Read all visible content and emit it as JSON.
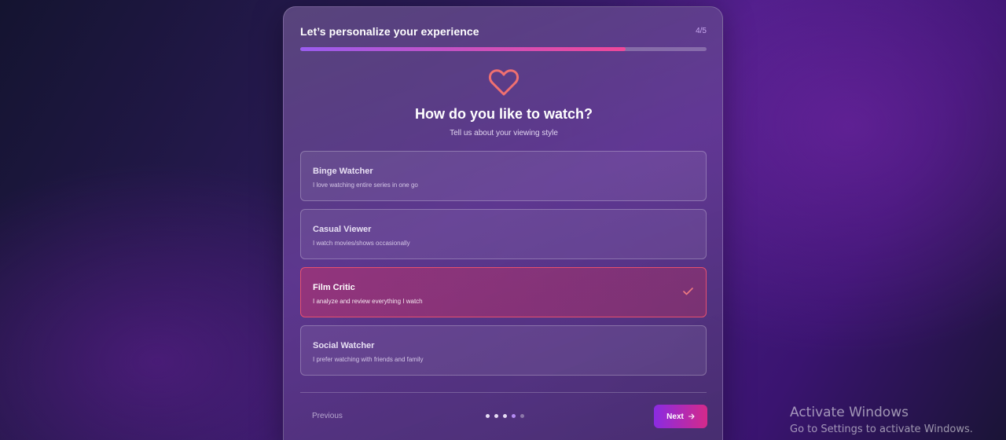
{
  "header": {
    "title": "Let’s personalize your experience",
    "step": "4/5",
    "progress_fraction": 0.8
  },
  "hero": {
    "icon": "heart-icon",
    "question": "How do you like to watch?",
    "subtitle": "Tell us about your viewing style"
  },
  "options": [
    {
      "title": "Binge Watcher",
      "desc": "I love watching entire series in one go",
      "selected": false
    },
    {
      "title": "Casual Viewer",
      "desc": "I watch movies/shows occasionally",
      "selected": false
    },
    {
      "title": "Film Critic",
      "desc": "I analyze and review everything I watch",
      "selected": true
    },
    {
      "title": "Social Watcher",
      "desc": "I prefer watching with friends and family",
      "selected": false
    }
  ],
  "footer": {
    "previous_label": "Previous",
    "next_label": "Next",
    "total_steps": 5,
    "current_step": 4
  },
  "windows_watermark": {
    "title": "Activate Windows",
    "subtitle": "Go to Settings to activate Windows."
  },
  "colors": {
    "accent_pink": "#e8506e",
    "accent_purple": "#8a2be2",
    "progress_start": "#9a5cf0",
    "progress_end": "#f0489a"
  }
}
